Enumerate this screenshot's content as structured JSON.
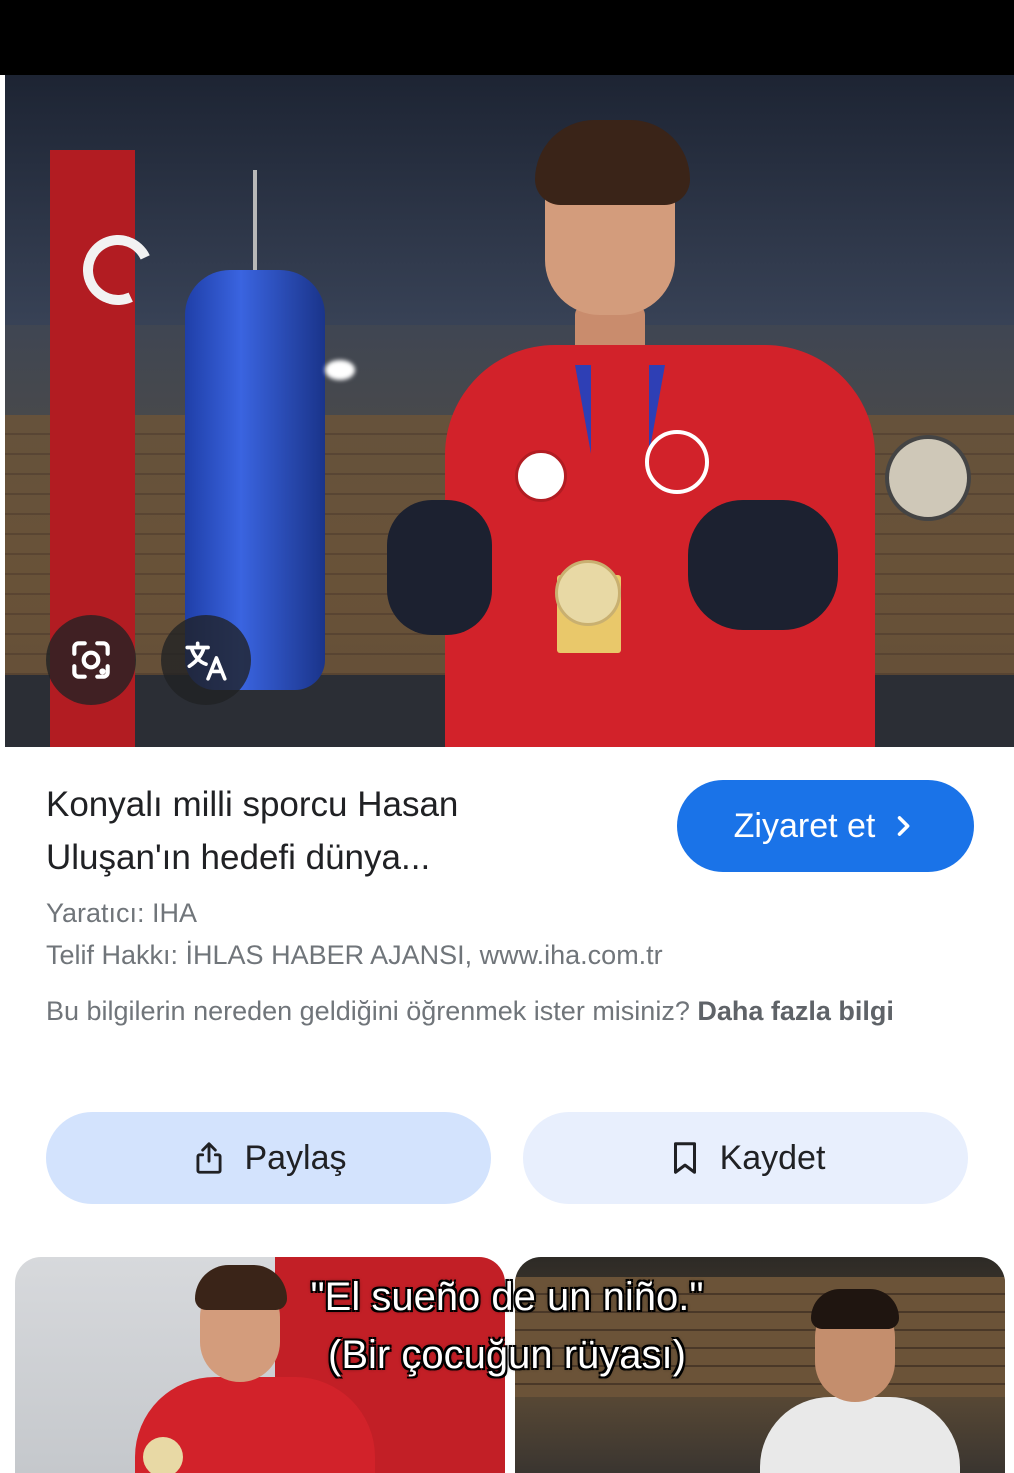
{
  "result": {
    "title": "Konyalı milli sporcu Hasan Uluşan'ın hedefi dünya...",
    "visit_label": "Ziyaret et",
    "creator": "Yaratıcı: IHA",
    "copyright": "Telif Hakkı: İHLAS HABER AJANSI, www.iha.com.tr",
    "info_question": "Bu bilgilerin nereden geldiğini öğrenmek ister misiniz?",
    "info_link": "Daha fazla bilgi"
  },
  "actions": {
    "share_label": "Paylaş",
    "save_label": "Kaydet"
  },
  "image_tools": {
    "lens_icon": "lens-icon",
    "translate_icon": "translate-icon"
  },
  "caption": {
    "line1": "\"El sueño de un niño.\"",
    "line2": "(Bir çocuğun rüyası)"
  },
  "colors": {
    "accent": "#1a73e8",
    "share_bg": "#d3e3fd",
    "save_bg": "#e8effd"
  }
}
